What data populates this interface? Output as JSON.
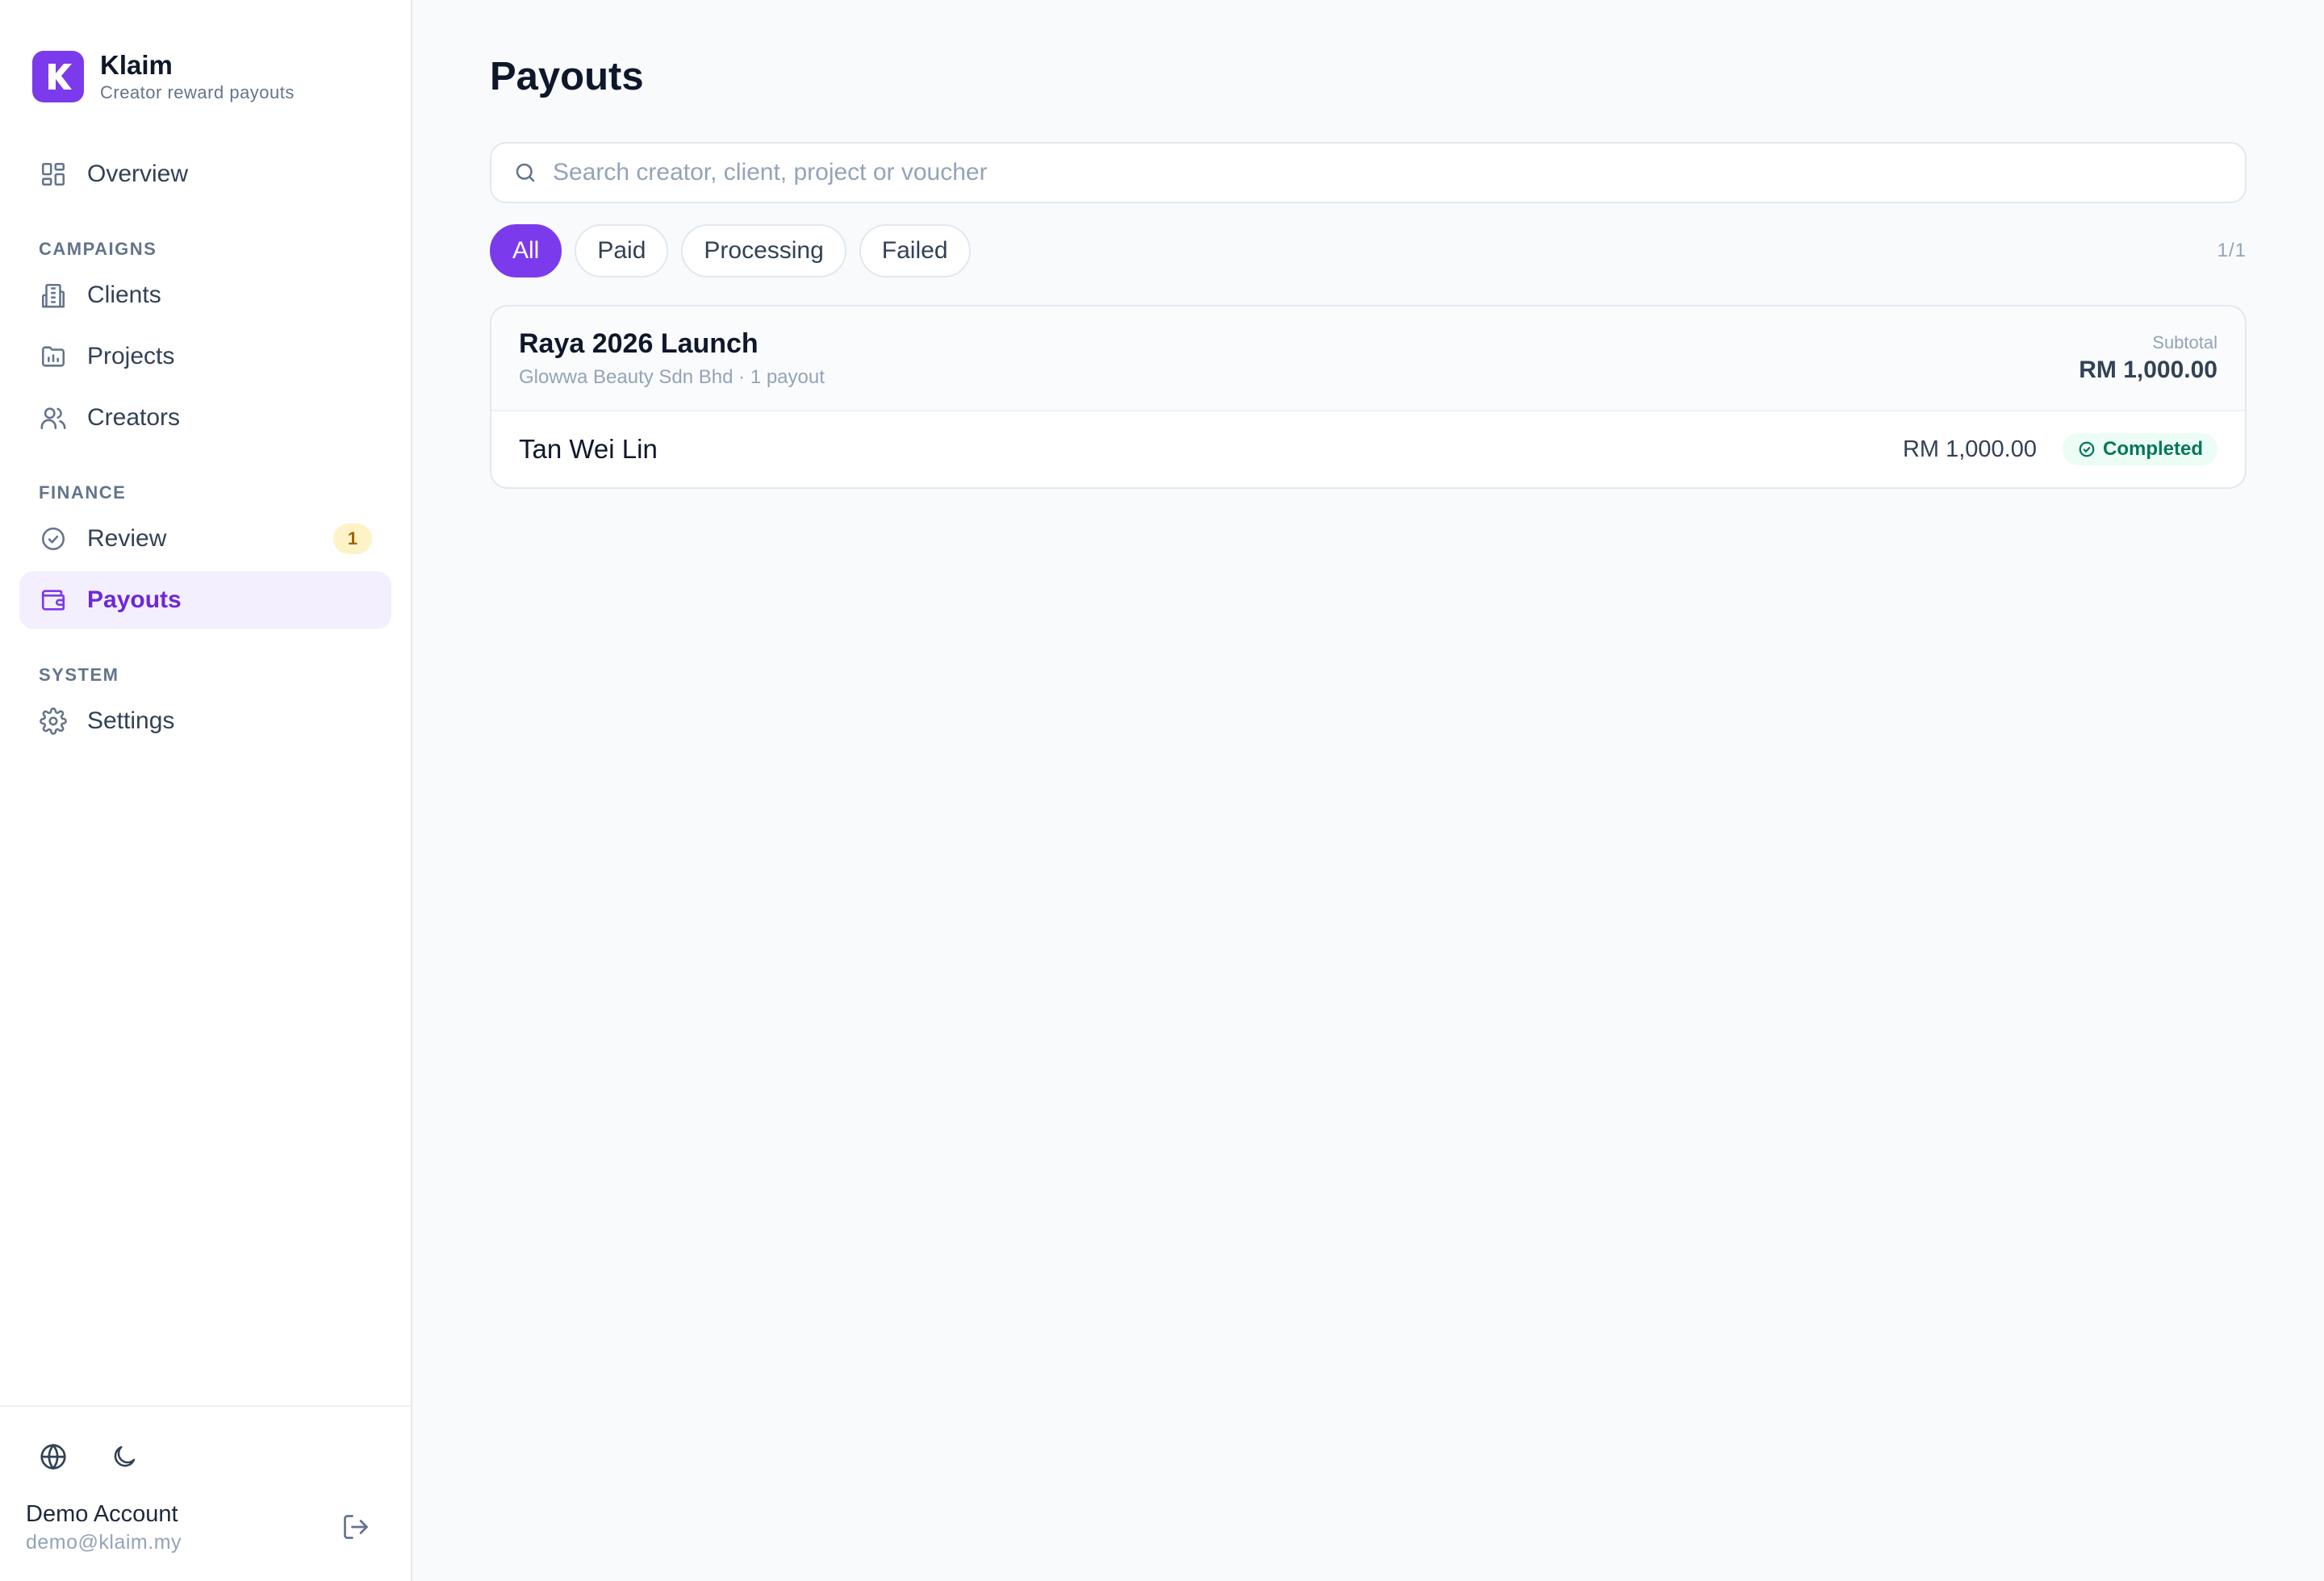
{
  "brand": {
    "name": "Klaim",
    "tagline": "Creator reward payouts",
    "logo_letter": "K",
    "color": "#7c3aed"
  },
  "sidebar": {
    "overview": {
      "label": "Overview",
      "icon": "dashboard-icon"
    },
    "sections": {
      "campaigns": "CAMPAIGNS",
      "finance": "FINANCE",
      "system": "SYSTEM"
    },
    "clients": {
      "label": "Clients",
      "icon": "building-icon"
    },
    "projects": {
      "label": "Projects",
      "icon": "folder-chart-icon"
    },
    "creators": {
      "label": "Creators",
      "icon": "users-icon"
    },
    "review": {
      "label": "Review",
      "icon": "check-circle-icon",
      "badge": "1"
    },
    "payouts": {
      "label": "Payouts",
      "icon": "wallet-icon",
      "active": true
    },
    "settings": {
      "label": "Settings",
      "icon": "gear-icon"
    }
  },
  "footer": {
    "language_icon": "globe-icon",
    "theme_icon": "moon-icon",
    "account_name": "Demo Account",
    "account_email": "demo@klaim.my",
    "logout_icon": "logout-icon"
  },
  "main": {
    "title": "Payouts",
    "search": {
      "placeholder": "Search creator, client, project or voucher",
      "value": ""
    },
    "filters": [
      {
        "label": "All",
        "active": true
      },
      {
        "label": "Paid",
        "active": false
      },
      {
        "label": "Processing",
        "active": false
      },
      {
        "label": "Failed",
        "active": false
      }
    ],
    "pager": "1/1",
    "groups": [
      {
        "title": "Raya 2026 Launch",
        "meta": "Glowwa Beauty Sdn Bhd · 1 payout",
        "subtotal_label": "Subtotal",
        "subtotal": "RM 1,000.00",
        "payouts": [
          {
            "creator": "Tan Wei Lin",
            "amount": "RM 1,000.00",
            "status": "Completed",
            "status_color": "#047857"
          }
        ]
      }
    ]
  },
  "colors": {
    "accent": "#7c3aed",
    "active_bg": "#f3effe",
    "badge_bg": "#fef3c7",
    "success_bg": "#ecfdf5",
    "success": "#047857"
  }
}
